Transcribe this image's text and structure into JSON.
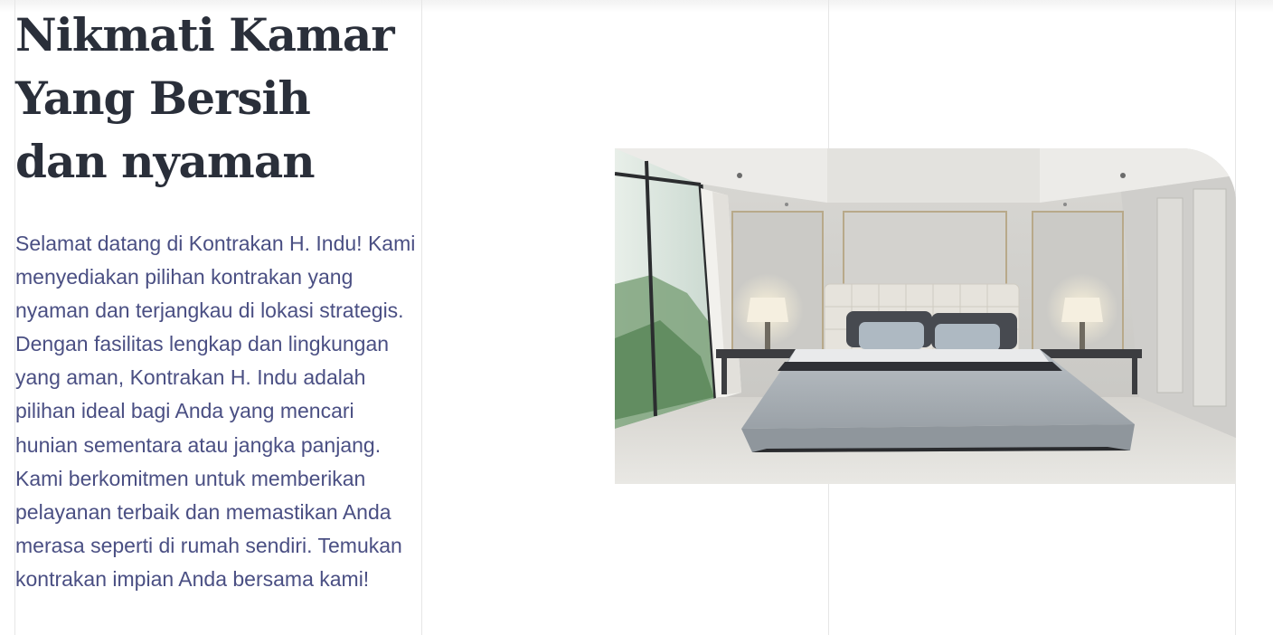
{
  "hero": {
    "heading": "Nikmati Kamar Yang Bersih dan nyaman",
    "description": "Selamat datang di Kontrakan H. Indu! Kami menyediakan pilihan kontrakan yang nyaman dan terjangkau di lokasi strategis. Dengan fasilitas lengkap dan lingkungan yang aman, Kontrakan H. Indu adalah pilihan ideal bagi Anda yang mencari hunian sementara atau jangka panjang. Kami berkomitmen untuk memberikan pelayanan terbaik dan memastikan Anda merasa seperti di rumah sendiri. Temukan kontrakan impian Anda bersama kami!"
  },
  "colors": {
    "heading": "#2a2f3a",
    "body_text": "#4a4f83",
    "grid_line": "#e6e6e6"
  }
}
